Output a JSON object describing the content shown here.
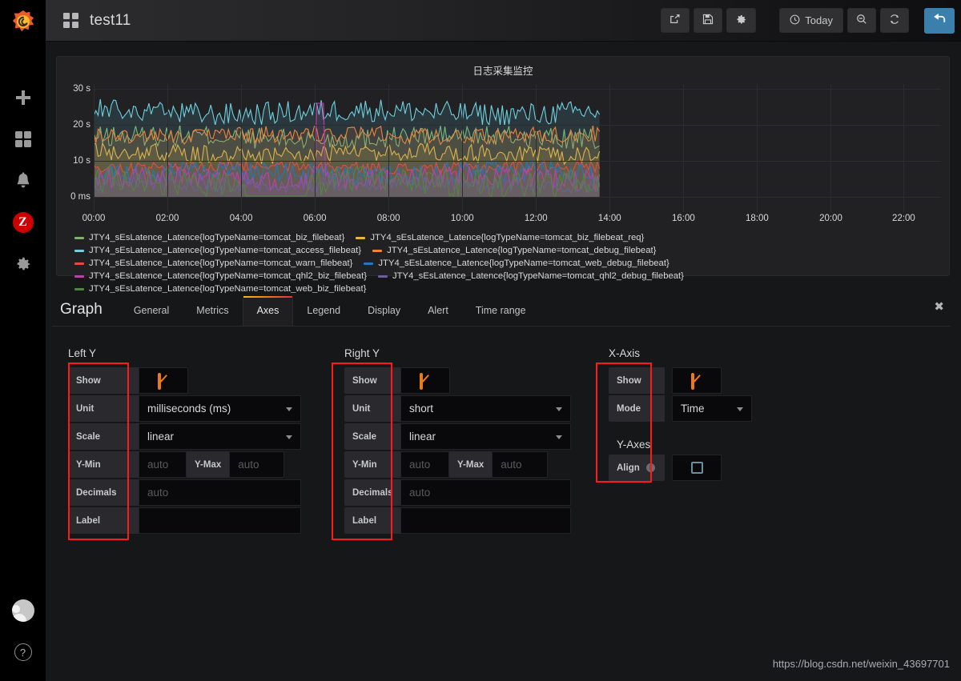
{
  "sidebar": {
    "logo": "grafana-logo",
    "items": [
      {
        "name": "create-add",
        "icon": "plus-icon"
      },
      {
        "name": "dashboards",
        "icon": "dashboard-grid-icon"
      },
      {
        "name": "alerting",
        "icon": "bell-icon"
      },
      {
        "name": "zabbix",
        "icon": "z-badge-icon",
        "label": "Z"
      },
      {
        "name": "configuration",
        "icon": "gear-icon"
      }
    ],
    "bottom": [
      {
        "name": "user-profile",
        "icon": "user-avatar-icon"
      },
      {
        "name": "help",
        "icon": "question-circle-icon",
        "label": "?"
      }
    ]
  },
  "navbar": {
    "dash_icon": "dashboard-grid-icon",
    "title": "test11",
    "buttons": [
      {
        "name": "share-dashboard",
        "icon": "share-icon",
        "label": ""
      },
      {
        "name": "save-dashboard",
        "icon": "save-floppy-icon",
        "label": ""
      },
      {
        "name": "dashboard-settings",
        "icon": "gear-icon",
        "label": ""
      }
    ],
    "time_picker": {
      "icon": "clock-icon",
      "label": "Today"
    },
    "zoom_out": {
      "name": "zoom-out",
      "icon": "search-minus-icon"
    },
    "refresh": {
      "name": "refresh",
      "icon": "refresh-icon"
    },
    "back": {
      "name": "back-to-dashboard",
      "icon": "arrow-back-icon"
    }
  },
  "panel": {
    "title": "日志采集监控",
    "y_ticks": [
      "30 s",
      "20 s",
      "10 s",
      "0 ms"
    ],
    "x_ticks": [
      "00:00",
      "02:00",
      "04:00",
      "06:00",
      "08:00",
      "10:00",
      "12:00",
      "14:00",
      "16:00",
      "18:00",
      "20:00",
      "22:00"
    ],
    "legend": [
      {
        "color": "#7eb26d",
        "label": "JTY4_sEsLatence_Latence{logTypeName=tomcat_biz_filebeat}"
      },
      {
        "color": "#eab839",
        "label": "JTY4_sEsLatence_Latence{logTypeName=tomcat_biz_filebeat_req}"
      },
      {
        "color": "#6ed0e0",
        "label": "JTY4_sEsLatence_Latence{logTypeName=tomcat_access_filebeat}"
      },
      {
        "color": "#ef843c",
        "label": "JTY4_sEsLatence_Latence{logTypeName=tomcat_debug_filebeat}"
      },
      {
        "color": "#e24d42",
        "label": "JTY4_sEsLatence_Latence{logTypeName=tomcat_warn_filebeat}"
      },
      {
        "color": "#1f78c1",
        "label": "JTY4_sEsLatence_Latence{logTypeName=tomcat_web_debug_filebeat}"
      },
      {
        "color": "#ba43a9",
        "label": "JTY4_sEsLatence_Latence{logTypeName=tomcat_qhl2_biz_filebeat}"
      },
      {
        "color": "#705da0",
        "label": "JTY4_sEsLatence_Latence{logTypeName=tomcat_qhl2_debug_filebeat}"
      },
      {
        "color": "#508642",
        "label": "JTY4_sEsLatence_Latence{logTypeName=tomcat_web_biz_filebeat}"
      }
    ]
  },
  "chart_data": {
    "type": "line",
    "title": "日志采集监控",
    "xlabel": "",
    "ylabel": "",
    "ylim": [
      0,
      30
    ],
    "ytick_labels": [
      "0 ms",
      "10 s",
      "20 s",
      "30 s"
    ],
    "ytick_values": [
      0,
      10,
      20,
      30
    ],
    "x": [
      "00:00",
      "02:00",
      "04:00",
      "06:00",
      "08:00",
      "10:00",
      "12:00",
      "14:00",
      "16:00",
      "18:00",
      "20:00",
      "22:00"
    ],
    "xlim": [
      "00:00",
      "23:30"
    ],
    "grid": true,
    "legend_position": "bottom",
    "data_end": "13:45",
    "series": [
      {
        "name": "JTY4_sEsLatence_Latence{logTypeName=tomcat_biz_filebeat}",
        "color": "#7eb26d",
        "mean": 16.5,
        "min": 13.0,
        "max": 19.5
      },
      {
        "name": "JTY4_sEsLatence_Latence{logTypeName=tomcat_biz_filebeat_req}",
        "color": "#eab839",
        "mean": 12.0,
        "min": 9.5,
        "max": 15.0
      },
      {
        "name": "JTY4_sEsLatence_Latence{logTypeName=tomcat_access_filebeat}",
        "color": "#6ed0e0",
        "mean": 23.5,
        "min": 19.5,
        "max": 26.5
      },
      {
        "name": "JTY4_sEsLatence_Latence{logTypeName=tomcat_debug_filebeat}",
        "color": "#ef843c",
        "mean": 17.2,
        "min": 15.0,
        "max": 20.0
      },
      {
        "name": "JTY4_sEsLatence_Latence{logTypeName=tomcat_warn_filebeat}",
        "color": "#e24d42",
        "mean": 8.2,
        "min": 6.5,
        "max": 10.0
      },
      {
        "name": "JTY4_sEsLatence_Latence{logTypeName=tomcat_web_debug_filebeat}",
        "color": "#1f78c1",
        "mean": 6.5,
        "min": 3.0,
        "max": 9.5
      },
      {
        "name": "JTY4_sEsLatence_Latence{logTypeName=tomcat_qhl2_biz_filebeat}",
        "color": "#ba43a9",
        "mean": 5.0,
        "min": 2.0,
        "max": 8.5
      },
      {
        "name": "JTY4_sEsLatence_Latence{logTypeName=tomcat_qhl2_debug_filebeat}",
        "color": "#705da0",
        "mean": 3.5,
        "min": 1.5,
        "max": 6.0
      },
      {
        "name": "JTY4_sEsLatence_Latence{logTypeName=tomcat_web_biz_filebeat}",
        "color": "#508642",
        "mean": 4.0,
        "min": 0.2,
        "max": 8.5
      }
    ]
  },
  "editor": {
    "heading": "Graph",
    "tabs": [
      {
        "label": "General",
        "active": false
      },
      {
        "label": "Metrics",
        "active": false
      },
      {
        "label": "Axes",
        "active": true
      },
      {
        "label": "Legend",
        "active": false
      },
      {
        "label": "Display",
        "active": false
      },
      {
        "label": "Alert",
        "active": false
      },
      {
        "label": "Time range",
        "active": false
      }
    ],
    "close_icon": "close-icon",
    "left_y": {
      "title": "Left Y",
      "show": {
        "label": "Show",
        "checked": true
      },
      "unit": {
        "label": "Unit",
        "value": "milliseconds (ms)"
      },
      "scale": {
        "label": "Scale",
        "value": "linear"
      },
      "y_min": {
        "label": "Y-Min",
        "value": "",
        "placeholder": "auto"
      },
      "y_max": {
        "label": "Y-Max",
        "value": "",
        "placeholder": "auto"
      },
      "decimals": {
        "label": "Decimals",
        "value": "",
        "placeholder": "auto"
      },
      "label_field": {
        "label": "Label",
        "value": "",
        "placeholder": ""
      }
    },
    "right_y": {
      "title": "Right Y",
      "show": {
        "label": "Show",
        "checked": true
      },
      "unit": {
        "label": "Unit",
        "value": "short"
      },
      "scale": {
        "label": "Scale",
        "value": "linear"
      },
      "y_min": {
        "label": "Y-Min",
        "value": "",
        "placeholder": "auto"
      },
      "y_max": {
        "label": "Y-Max",
        "value": "",
        "placeholder": "auto"
      },
      "decimals": {
        "label": "Decimals",
        "value": "",
        "placeholder": "auto"
      },
      "label_field": {
        "label": "Label",
        "value": "",
        "placeholder": ""
      }
    },
    "x_axis": {
      "title": "X-Axis",
      "show": {
        "label": "Show",
        "checked": true
      },
      "mode": {
        "label": "Mode",
        "value": "Time"
      },
      "y_axes_title": "Y-Axes",
      "align": {
        "label": "Align",
        "checked": false,
        "info_icon": "info-icon"
      }
    }
  },
  "watermark": "https://blog.csdn.net/weixin_43697701",
  "colors": {
    "accent_orange": "#eb7b18",
    "annotation_red": "#ff1a1a",
    "back_button_blue": "#3b7fad",
    "panel_bg": "#212124",
    "page_bg": "#161719"
  }
}
